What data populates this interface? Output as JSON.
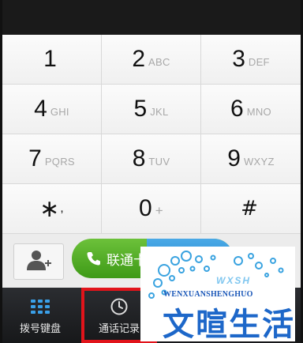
{
  "keypad": {
    "keys": [
      {
        "digit": "1",
        "letters": ""
      },
      {
        "digit": "2",
        "letters": "ABC"
      },
      {
        "digit": "3",
        "letters": "DEF"
      },
      {
        "digit": "4",
        "letters": "GHI"
      },
      {
        "digit": "5",
        "letters": "JKL"
      },
      {
        "digit": "6",
        "letters": "MNO"
      },
      {
        "digit": "7",
        "letters": "PQRS"
      },
      {
        "digit": "8",
        "letters": "TUV"
      },
      {
        "digit": "9",
        "letters": "WXYZ"
      },
      {
        "digit": "∗",
        "letters": ","
      },
      {
        "digit": "0",
        "letters": "+"
      },
      {
        "digit": "#",
        "letters": ""
      }
    ]
  },
  "actions": {
    "call_label": "联通卡"
  },
  "tabs": [
    {
      "label": "拨号键盘",
      "icon": "dialpad-icon"
    },
    {
      "label": "通话记录",
      "icon": "clock-icon"
    }
  ],
  "watermark": {
    "url_text": "WENXUANSHENGHUO",
    "title": "文暄生活",
    "abbr": "WXSH"
  },
  "colors": {
    "call_green": "#4fae24",
    "call_blue": "#2a8fd6",
    "highlight_red": "#e1141b",
    "tabbar_dark": "#1f2023"
  }
}
